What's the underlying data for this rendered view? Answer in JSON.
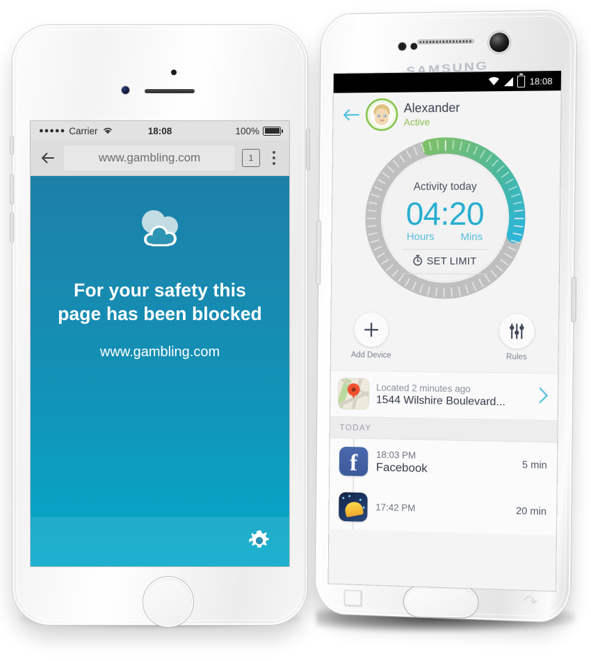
{
  "iphone": {
    "status": {
      "signal_dots": "●●●●●",
      "carrier": "Carrier",
      "wifi_icon": "wifi-icon",
      "time": "18:08",
      "battery_percent": "100%"
    },
    "browser": {
      "back_icon": "arrow-left-icon",
      "url": "www.gambling.com",
      "tab_count": "1",
      "menu_icon": "overflow-menu-icon"
    },
    "blocked": {
      "cloud_icon": "cloud-block-icon",
      "headline": "For your safety this page has been blocked",
      "url": "www.gambling.com",
      "settings_icon": "gear-icon"
    },
    "colors": {
      "gradient_top": "#1d80a8",
      "gradient_bottom": "#04a9ca"
    }
  },
  "android": {
    "brand": "SAMSUNG",
    "status": {
      "wifi_icon": "wifi-icon",
      "signal_icon": "signal-icon",
      "battery_icon": "battery-icon",
      "time": "18:08"
    },
    "header": {
      "back_icon": "arrow-left-icon",
      "avatar": "child-avatar",
      "name": "Alexander",
      "status": "Active"
    },
    "dial": {
      "label": "Activity today",
      "time": "04:20",
      "hours_label": "Hours",
      "mins_label": "Mins",
      "set_limit": "SET LIMIT",
      "timer_icon": "stopwatch-icon",
      "arc_start_color": "#7cc06a",
      "arc_end_color": "#2cb5d8",
      "track_color": "#bfbfbf"
    },
    "actions": [
      {
        "icon": "plus-icon",
        "label": "Add Device"
      },
      {
        "icon": "sliders-icon",
        "label": "Rules"
      }
    ],
    "location": {
      "map_icon": "map-pin-icon",
      "when": "Located 2 minutes ago",
      "address": "1544 Wilshire Boulevard...",
      "chevron_icon": "chevron-right-icon"
    },
    "timeline": {
      "section_label": "TODAY",
      "rows": [
        {
          "icon": "facebook-icon",
          "time": "18:03 PM",
          "app": "Facebook",
          "duration": "5 min"
        },
        {
          "icon": "game-icon",
          "time": "17:42 PM",
          "app": "",
          "duration": "20 min"
        }
      ]
    },
    "nav": {
      "recents_icon": "recents-icon",
      "home_icon": "home-button",
      "back_icon": "back-icon"
    }
  }
}
